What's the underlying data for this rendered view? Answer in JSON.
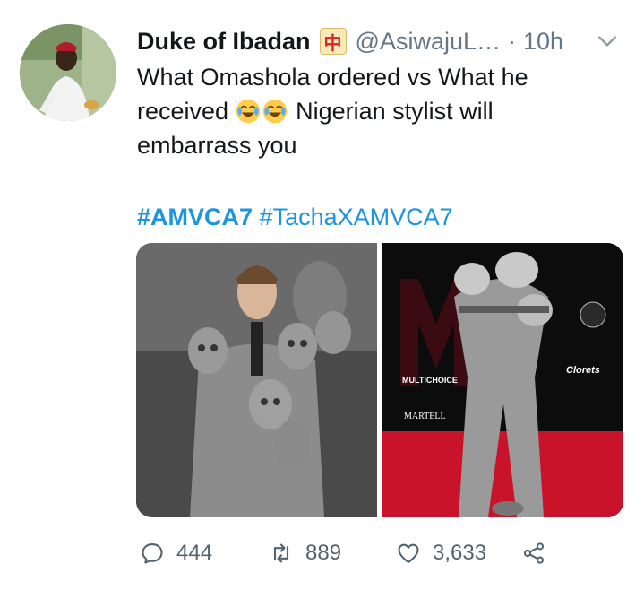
{
  "tweet": {
    "author": {
      "name": "Duke of Ibadan",
      "name_emoji": "mahjong-red-dragon-emoji",
      "handle": "@AsiwajuL…",
      "separator": "·",
      "time": "10h",
      "avatar_icon": "avatar"
    },
    "text": {
      "line1": "What Omashola ordered vs What he",
      "line2_prefix": "received",
      "line2_emoji": "face-with-tears-of-joy-emoji",
      "line2_suffix": "Nigerian stylist will",
      "line3": "embarrass you"
    },
    "hashtags": [
      "#AMVCA7",
      "#TachaXAMVCA7"
    ],
    "media": {
      "left": {
        "desc_icon": "photo-model-grey-suit"
      },
      "right": {
        "desc_icon": "photo-red-carpet-outfit",
        "backdrop_texts": [
          "MULTICHOICE",
          "MARTELL",
          "Clorets"
        ]
      }
    },
    "actions": {
      "reply_count": "444",
      "retweet_count": "889",
      "like_count": "3,633"
    },
    "colors": {
      "link": "#1b95e0",
      "secondary": "#657786",
      "text": "#14171a"
    }
  }
}
